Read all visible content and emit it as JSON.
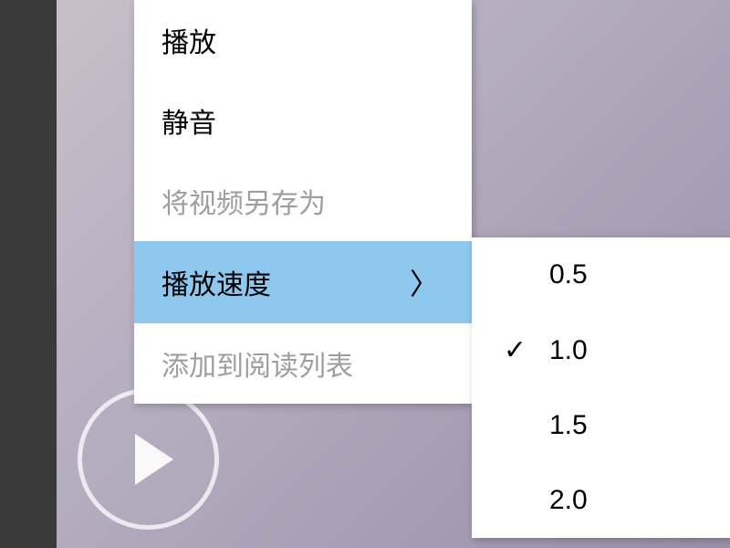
{
  "menu": {
    "items": [
      {
        "label": "播放",
        "disabled": false,
        "highlighted": false
      },
      {
        "label": "静音",
        "disabled": false,
        "highlighted": false
      },
      {
        "label": "将视频另存为",
        "disabled": true,
        "highlighted": false
      },
      {
        "label": "播放速度",
        "disabled": false,
        "highlighted": true,
        "hasSubmenu": true
      },
      {
        "label": "添加到阅读列表",
        "disabled": true,
        "highlighted": false
      }
    ]
  },
  "submenu": {
    "items": [
      {
        "label": "0.5",
        "checked": false
      },
      {
        "label": "1.0",
        "checked": true
      },
      {
        "label": "1.5",
        "checked": false
      },
      {
        "label": "2.0",
        "checked": false
      }
    ]
  },
  "icons": {
    "chevron_right": "〉",
    "check": "✓"
  }
}
